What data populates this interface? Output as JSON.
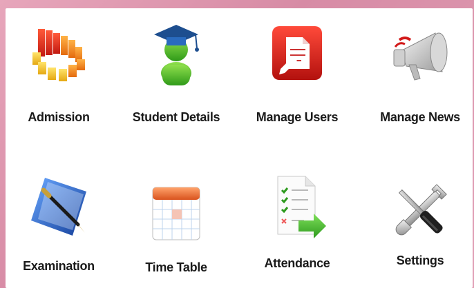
{
  "tiles": [
    {
      "label": "Admission",
      "icon": "bar-chart-ring-icon"
    },
    {
      "label": "Student Details",
      "icon": "graduate-student-icon"
    },
    {
      "label": "Manage Users",
      "icon": "edit-document-icon"
    },
    {
      "label": "Manage News",
      "icon": "megaphone-icon"
    },
    {
      "label": "Examination",
      "icon": "notebook-pen-icon"
    },
    {
      "label": "Time Table",
      "icon": "calendar-icon"
    },
    {
      "label": "Attendance",
      "icon": "checklist-arrow-icon"
    },
    {
      "label": "Settings",
      "icon": "wrench-screwdriver-icon"
    }
  ],
  "colors": {
    "frame": "#d78ba5",
    "panel": "#ffffff",
    "label": "#1a1a1a"
  }
}
